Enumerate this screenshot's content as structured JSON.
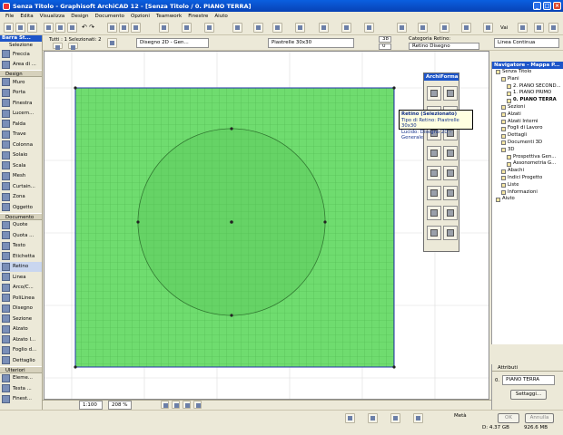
{
  "window": {
    "title": "Senza Titolo - Graphisoft ArchiCAD 12 - [Senza Titolo / 0. PIANO TERRA]",
    "minimize": "_",
    "maximize": "□",
    "close": "×"
  },
  "menu": [
    "File",
    "Edita",
    "Visualizza",
    "Design",
    "Documento",
    "Opzioni",
    "Teamwork",
    "Finestre",
    "Aiuto"
  ],
  "toolbar": {
    "undo_redo": "↶ ↷",
    "fill_label": "Retino",
    "fill_value": "Retino Disegno",
    "layer_value": "Disegno 2D - Gen...",
    "pattern_value": "Piastrelle 30x30",
    "pen_value": "38",
    "pen2_value": "0",
    "cat_label": "Categoria Retino:",
    "line_type": "Linea Continua",
    "zoom_label": "Vai"
  },
  "selection": {
    "label": "Tutti : 1   Selezionati: 2"
  },
  "toolbox": {
    "title": "Barra St...",
    "subtitle": "Selezione",
    "items_top": [
      "Freccia",
      "Area di ..."
    ],
    "design_label": "Design",
    "design_items": [
      "Muro",
      "Porta",
      "Finestra",
      "Lucern...",
      "Falda",
      "Trave",
      "Colonna",
      "Solaio",
      "Scala",
      "Mesh",
      "Curtain...",
      "Zona",
      "Oggetto"
    ],
    "doc_label": "Documento",
    "doc_items": [
      "Quote",
      "Quota ...",
      "Testo",
      "Etichetta",
      "Retino",
      "Linea",
      "Arco/C...",
      "PoliLinea",
      "Disegno",
      "Sezione",
      "Alzato",
      "Alzato I...",
      "Foglio d...",
      "Dettaglio"
    ],
    "more_label": "Ulteriori",
    "more_items": [
      "Eleme...",
      "Testa ...",
      "Finest..."
    ]
  },
  "palette": {
    "title": "ArchiForma"
  },
  "tooltip": {
    "line1": "Retino (Selezionato)",
    "line2": "Tipo di Retino: Piastrelle 30x30",
    "line3": "Lucido: Disegno 2D - Generale"
  },
  "navigator": {
    "title": "Navigatore - Mappa P...",
    "items": [
      {
        "label": "Senza Titolo",
        "indent": 0
      },
      {
        "label": "Piani",
        "indent": 1
      },
      {
        "label": "2. PIANO SECOND...",
        "indent": 2
      },
      {
        "label": "1. PIANO PRIMO",
        "indent": 2
      },
      {
        "label": "0. PIANO TERRA",
        "indent": 2,
        "bold": true
      },
      {
        "label": "Sezioni",
        "indent": 1
      },
      {
        "label": "Alzati",
        "indent": 1
      },
      {
        "label": "Alzati Interni",
        "indent": 1
      },
      {
        "label": "Fogli di Lavoro",
        "indent": 1
      },
      {
        "label": "Dettagli",
        "indent": 1
      },
      {
        "label": "Documenti 3D",
        "indent": 1
      },
      {
        "label": "3D",
        "indent": 1
      },
      {
        "label": "Prospettiva Gen...",
        "indent": 2
      },
      {
        "label": "Assonometria G...",
        "indent": 2
      },
      {
        "label": "Abachi",
        "indent": 1
      },
      {
        "label": "Indici Progetto",
        "indent": 1
      },
      {
        "label": "Liste",
        "indent": 1
      },
      {
        "label": "Informazioni",
        "indent": 1
      },
      {
        "label": "Aiuto",
        "indent": 0
      }
    ]
  },
  "attributes": {
    "title": "Attributi",
    "floor": "PIANO TERRA",
    "floor_num": "0.",
    "settings_button": "Settaggi..."
  },
  "status": {
    "scale": "1:100",
    "zoom": "208 %",
    "meta": "Metà",
    "ok": "OK",
    "cancel": "Annulla",
    "disk": "D: 4.37 GB",
    "memory": "926.6 MB"
  },
  "colors": {
    "fill_green": "#6fdc6f",
    "grid_line": "#4fb84f",
    "selection_blue": "#2233aa"
  }
}
